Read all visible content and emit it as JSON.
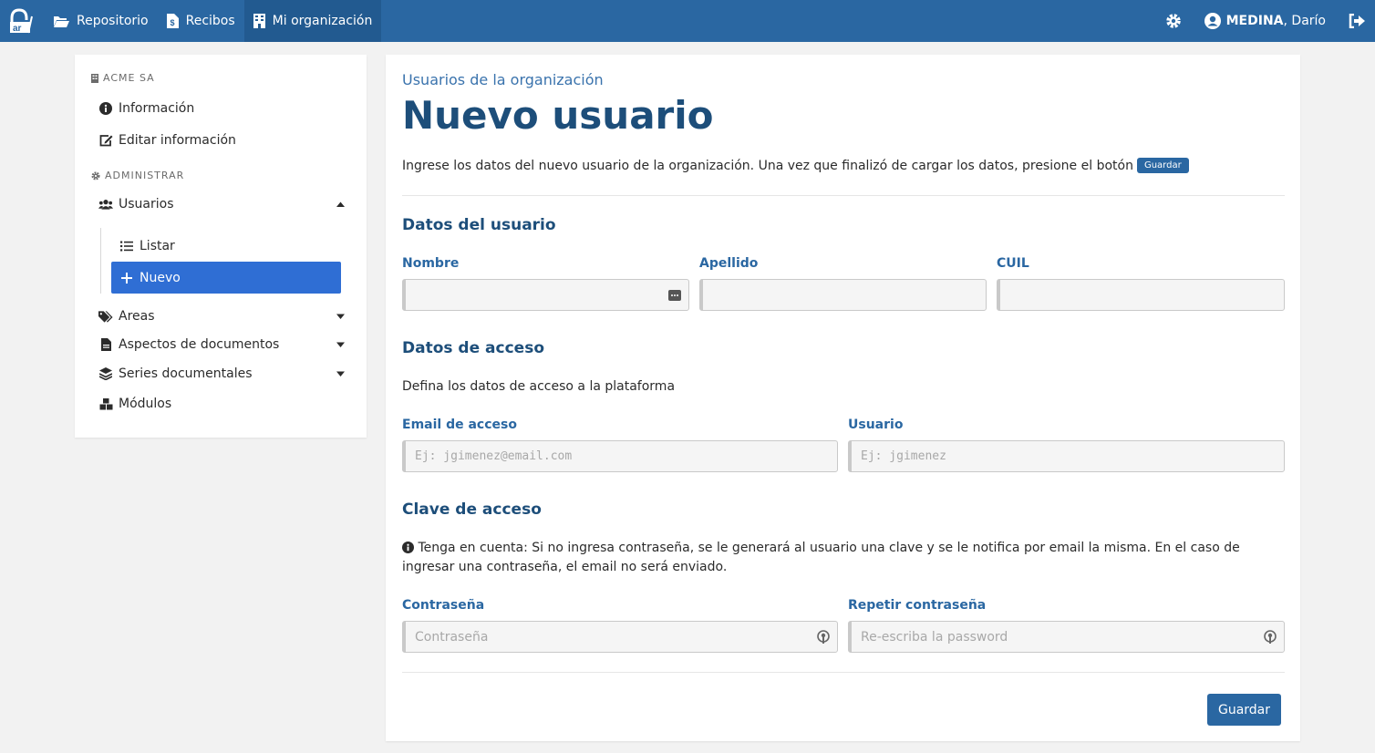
{
  "topbar": {
    "logo_label": "ar",
    "nav": [
      {
        "label": "Repositorio",
        "icon": "folder-open-icon"
      },
      {
        "label": "Recibos",
        "icon": "file-invoice-dollar-icon"
      },
      {
        "label": "Mi organización",
        "icon": "building-icon",
        "active": true
      }
    ],
    "user_lastname": "MEDINA",
    "user_firstname": ", Darío"
  },
  "sidebar": {
    "org_name": "ACME SA",
    "info_label": "Información",
    "edit_label": "Editar información",
    "admin_heading": "ADMINISTRAR",
    "usuarios_label": "Usuarios",
    "listar_label": "Listar",
    "nuevo_label": "Nuevo",
    "areas_label": "Areas",
    "aspectos_label": "Aspectos de documentos",
    "series_label": "Series documentales",
    "modulos_label": "Módulos"
  },
  "main": {
    "subtitle": "Usuarios de la organización",
    "title": "Nuevo usuario",
    "intro": "Ingrese los datos del nuevo usuario de la organización. Una vez que finalizó de cargar los datos, presione el botón",
    "intro_badge": "Guardar",
    "section_user": "Datos del usuario",
    "nombre_label": "Nombre",
    "apellido_label": "Apellido",
    "cuil_label": "CUIL",
    "section_access": "Datos de acceso",
    "access_desc": "Defina los datos de acceso a la plataforma",
    "email_label": "Email de acceso",
    "email_placeholder": "Ej: jgimenez@email.com",
    "usuario_label": "Usuario",
    "usuario_placeholder": "Ej: jgimenez",
    "section_password": "Clave de acceso",
    "password_note": "Tenga en cuenta: Si no ingresa contraseña, se le generará al usuario una clave y se le notifica por email la misma. En el caso de ingresar una contraseña, el email no será enviado.",
    "password_label": "Contraseña",
    "password_placeholder": "Contraseña",
    "repeat_label": "Repetir contraseña",
    "repeat_placeholder": "Re-escriba la password",
    "save_label": "Guardar"
  },
  "colors": {
    "primary": "#2a67a2",
    "heading": "#1d4e7a",
    "active_item": "#2f6ed4"
  }
}
